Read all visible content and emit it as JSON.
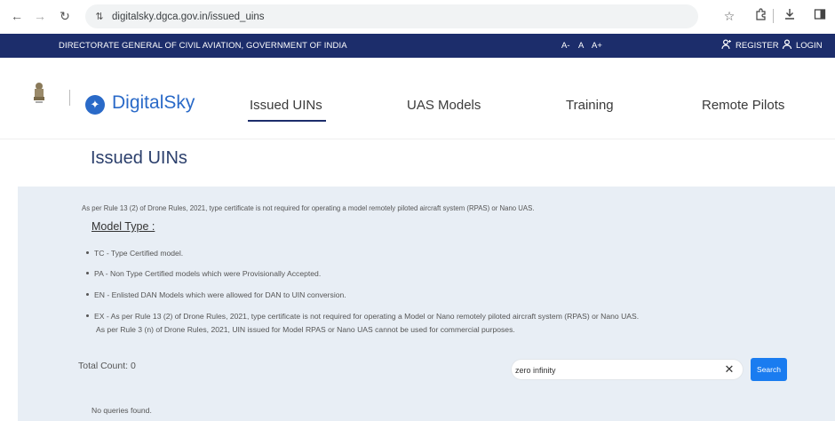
{
  "browser": {
    "url": "digitalsky.dgca.gov.in/issued_uins"
  },
  "govbar": {
    "title": "DIRECTORATE GENERAL OF CIVIL AVIATION, GOVERNMENT OF INDIA",
    "font_small": "A-",
    "font_normal": "A",
    "font_large": "A+",
    "register": "REGISTER",
    "login": "LOGIN"
  },
  "header": {
    "logo_text": "DigitalSky",
    "nav": [
      "Issued UINs",
      "UAS Models",
      "Training",
      "Remote Pilots"
    ],
    "active_nav": "Issued UINs"
  },
  "page": {
    "title": "Issued UINs",
    "rule_note": "As per Rule 13 (2) of Drone Rules, 2021, type certificate is not required for operating a model remotely piloted aircraft system (RPAS) or Nano UAS.",
    "model_type_heading": "Model Type :",
    "bullets": [
      "TC - Type Certified model.",
      "PA - Non Type Certified models which were Provisionally Accepted.",
      "EN - Enlisted DAN Models which were allowed for DAN to UIN conversion.",
      "EX - As per Rule 13 (2) of Drone Rules, 2021, type certificate is not required for operating a Model or Nano remotely piloted aircraft system (RPAS) or Nano UAS."
    ],
    "ex_continuation": "As per Rule 3 (n) of Drone Rules, 2021, UIN issued for Model RPAS or Nano UAS cannot be used for commercial purposes.",
    "total_count": "Total Count: 0",
    "search_value": "zero infinity",
    "search_button": "Search",
    "no_results": "No queries found."
  },
  "colors": {
    "govbar_bg": "#1c2d6b",
    "brand_blue": "#2a6ac8",
    "content_bg": "#e8eef5",
    "search_button": "#1a7cf0"
  }
}
